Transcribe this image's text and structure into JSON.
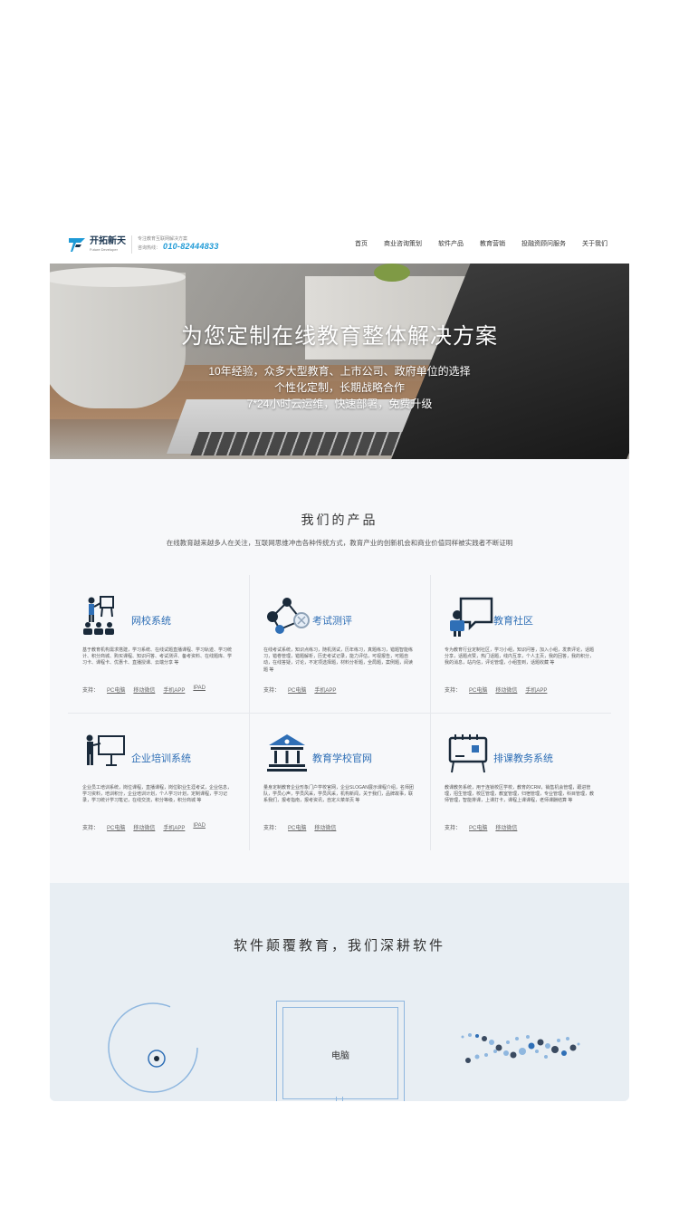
{
  "header": {
    "logo_cn": "开拓新天",
    "logo_en": "Future Developer",
    "slogan": "专注教育互联网解决方案",
    "phone_label": "咨询热线：",
    "phone": "010-82444833",
    "nav": [
      "首页",
      "商业咨询策划",
      "软件产品",
      "教育营销",
      "投融资顾问服务",
      "关于我们"
    ]
  },
  "hero": {
    "title": "为您定制在线教育整体解决方案",
    "lines": [
      "10年经验，众多大型教育、上市公司、政府单位的选择",
      "个性化定制，长期战略合作",
      "7*24小时云运维，快速部署，免费升级"
    ]
  },
  "products": {
    "title": "我们的产品",
    "subtitle": "在线教育越来越多人在关注，互联网思维冲击各种传统方式，教育产业的创新机会和商业价值同样被实践者不断证明",
    "support_label": "支持：",
    "items": [
      {
        "name": "网校系统",
        "icon": "classroom-icon",
        "desc": "基于教育机构需求搭建，学习系统、在线试题直播课程、学习轨迹、学习统计、积分商城、购买课程、知识问答、考试测评、备考资料、在线题库、学习卡、课程卡、优惠卡、直播授课、云端分享 等",
        "platforms": [
          "PC电脑",
          "移动微信",
          "手机APP",
          "IPAD"
        ]
      },
      {
        "name": "考试测评",
        "icon": "network-icon",
        "desc": "在线考试系统，知识点练习，随机测试，历年练习，真题练习，错题智能练习，错卷管理，错题解析，历史考试记录，能力评估，可视报告，可题自动，在线答疑，讨论，不定项选择题，材料分析题，全局题，案例题，阅读题 等",
        "platforms": [
          "PC电脑",
          "手机APP"
        ]
      },
      {
        "name": "教育社区",
        "icon": "teacher-chat-icon",
        "desc": "专为教育行业定制社区，学习小组，知识问答，加入小组，发表评论，话题分享，话题点赞，热门话题，线内互享，个人主页，我的回答，我的积分，我的消息，站内信，评论管理，小组签到，话题收藏 等",
        "platforms": [
          "PC电脑",
          "移动微信",
          "手机APP"
        ]
      },
      {
        "name": "企业培训系统",
        "icon": "presenter-icon",
        "desc": "企业员工培训系统，岗位课程，直播课程，岗位职业生涯考试，企业信息，学习资料，培训积分，企业培训计划，个人学习计划，定制课程，学习记录，学习统计学习笔记，在线交流，积分等级，积分商城 等",
        "platforms": [
          "PC电脑",
          "移动微信",
          "手机APP",
          "IPAD"
        ]
      },
      {
        "name": "教育学校官网",
        "icon": "school-icon",
        "desc": "量身定制教育企业形象门户学校官网，企业SLOGAN展示课程介绍，名师团队，学员心声，学员风采，学员风采，机构新闻，关于我们，品牌故事，联系我们，报考指南，报考资讯，自定义菜单页 等",
        "platforms": [
          "PC电脑",
          "移动微信"
        ]
      },
      {
        "name": "排课教务系统",
        "icon": "schedule-board-icon",
        "desc": "教课教务系统，用于连锁校区学校，教育的CRM，销售机会管理，跟进管理，招生管理，校区管理，教室管理，归宿管理，专业管理，科目管理，教师管理，智能排课，上课打卡，课程上课课程，老师课酬结算 等",
        "platforms": [
          "PC电脑",
          "移动微信"
        ]
      }
    ]
  },
  "bottom": {
    "title": "软件颠覆教育，我们深耕软件",
    "monitor_label": "电脑"
  }
}
